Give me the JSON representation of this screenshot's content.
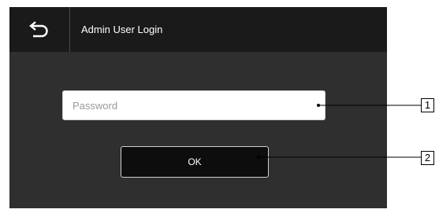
{
  "title_bar": {
    "back_icon": "back-arrow-icon",
    "title": "Admin User Login"
  },
  "login_form": {
    "password_placeholder": "Password",
    "ok_label": "OK"
  },
  "callouts": {
    "password_callout": "1",
    "ok_callout": "2"
  },
  "colors": {
    "screen_background": "#2f2f2f",
    "title_bar_background": "#1a1a1a",
    "button_background": "#0d0d0d",
    "text": "#ffffff"
  }
}
